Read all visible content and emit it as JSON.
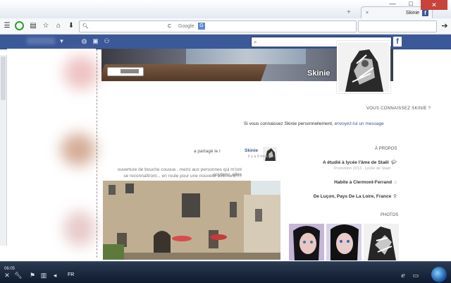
{
  "browser": {
    "tab_title": "Skinie",
    "tab_favicon": "f",
    "tab_close": "×",
    "new_tab": "+",
    "win_min": "—",
    "win_max": "□",
    "win_close": "✕",
    "search_engine_label": "Google",
    "search_engine_icon": "G",
    "reload": "C",
    "url": ""
  },
  "facebook": {
    "logo": "f",
    "search_placeholder": ""
  },
  "cover": {
    "name": "Skinie"
  },
  "know": {
    "question": "VOUS CONNAISSEZ SKINIE ?",
    "message_prefix": "Si vous connaissez Skinie personnellement,",
    "message_link": "envoyez-lui un message"
  },
  "about": {
    "title": "À PROPOS",
    "school": "A étudié à lycée l'âme de Staël",
    "school_sub": "Promotion 2013 · Lycée de Staël",
    "lives": "Habite à Clermont-Ferrand",
    "from": "De Luçon, Pays De La Loire, France",
    "photos_title": "PHOTOS"
  },
  "post": {
    "author": "Skinie",
    "time": "il y a 9 mois",
    "shared": "a partagé le l",
    "text_line1": "ouverture de bouche cousue , merci aux personnes qui m'ont soutenu. elles",
    "text_line2": "se reconnaîtront... en route pour une nouvelle aventure!!!!!"
  },
  "taskbar": {
    "language": "FR",
    "clock": "06:05"
  },
  "colors": {
    "facebook_blue": "#3b5998",
    "taskbar": "#0f1a2e"
  }
}
